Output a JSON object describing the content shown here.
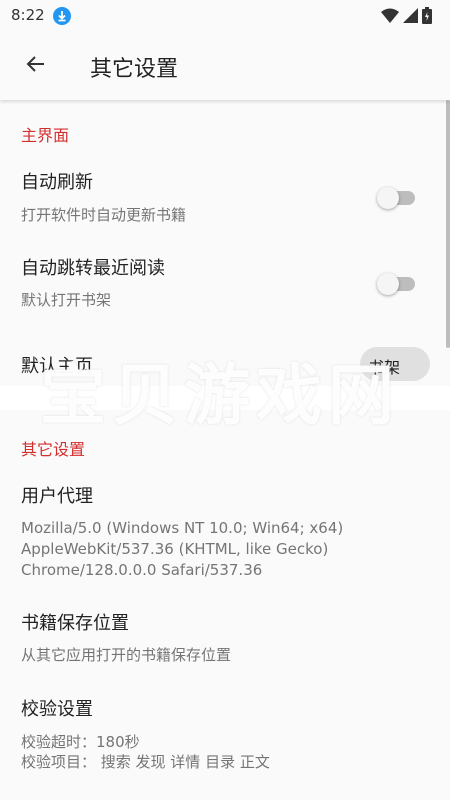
{
  "status_bar": {
    "time": "8:22",
    "icons": [
      "download-icon",
      "wifi-icon",
      "signal-icon",
      "battery-icon"
    ]
  },
  "app_bar": {
    "back_icon": "arrow-left-icon",
    "title": "其它设置"
  },
  "sections": {
    "main_ui": {
      "header": "主界面",
      "auto_refresh": {
        "title": "自动刷新",
        "summary": "打开软件时自动更新书籍",
        "enabled": false
      },
      "auto_jump": {
        "title": "自动跳转最近阅读",
        "summary": "默认打开书架",
        "enabled": false
      },
      "default_home": {
        "title": "默认主页",
        "value": "书架"
      }
    },
    "other": {
      "header": "其它设置",
      "user_agent": {
        "title": "用户代理",
        "summary": "Mozilla/5.0 (Windows NT 10.0; Win64; x64) AppleWebKit/537.36 (KHTML, like Gecko) Chrome/128.0.0.0 Safari/537.36"
      },
      "book_save": {
        "title": "书籍保存位置",
        "summary": "从其它应用打开的书籍保存位置"
      },
      "check": {
        "title": "校验设置",
        "timeout": "校验超时：180秒",
        "items": "校验项目： 搜索 发现 详情 目录 正文"
      }
    }
  },
  "watermark": {
    "text": "宝贝游戏网"
  },
  "colors": {
    "accent": "#d32f2f",
    "background": "#fafafa",
    "status_icon": "#2196f3"
  }
}
